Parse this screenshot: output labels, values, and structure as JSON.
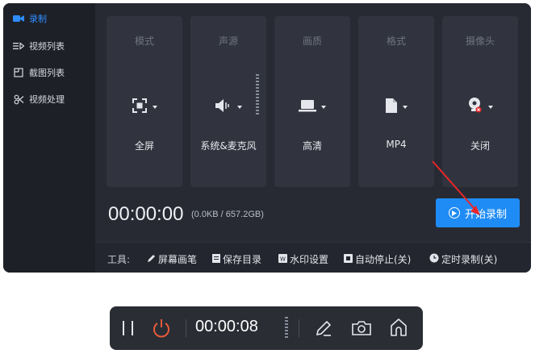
{
  "sidebar": {
    "items": [
      {
        "label": "录制",
        "icon": "camera-icon"
      },
      {
        "label": "视频列表",
        "icon": "video-list-icon"
      },
      {
        "label": "截图列表",
        "icon": "screenshot-list-icon"
      },
      {
        "label": "视频处理",
        "icon": "video-process-icon"
      }
    ]
  },
  "settings": [
    {
      "title": "模式",
      "value": "全屏",
      "icon": "fullscreen-icon"
    },
    {
      "title": "声源",
      "value": "系统&麦克风",
      "icon": "speaker-icon"
    },
    {
      "title": "画质",
      "value": "高清",
      "icon": "monitor-icon"
    },
    {
      "title": "格式",
      "value": "MP4",
      "icon": "file-icon"
    },
    {
      "title": "摄像头",
      "value": "关闭",
      "icon": "webcam-icon"
    }
  ],
  "recording": {
    "time": "00:00:00",
    "storage": "(0.0KB / 657.2GB)",
    "start_label": "开始录制"
  },
  "tools": {
    "label": "工具:",
    "items": [
      {
        "label": "屏幕画笔",
        "icon": "pen-icon"
      },
      {
        "label": "保存目录",
        "icon": "folder-icon"
      },
      {
        "label": "水印设置",
        "icon": "watermark-icon"
      },
      {
        "label": "自动停止(关)",
        "icon": "auto-stop-icon"
      },
      {
        "label": "定时录制(关)",
        "icon": "clock-icon"
      }
    ]
  },
  "mini_bar": {
    "time": "00:00:08"
  },
  "colors": {
    "accent": "#1f8cf5",
    "active_nav": "#2f8cff",
    "power": "#e85a3a",
    "annotation_arrow": "#e8262a"
  }
}
